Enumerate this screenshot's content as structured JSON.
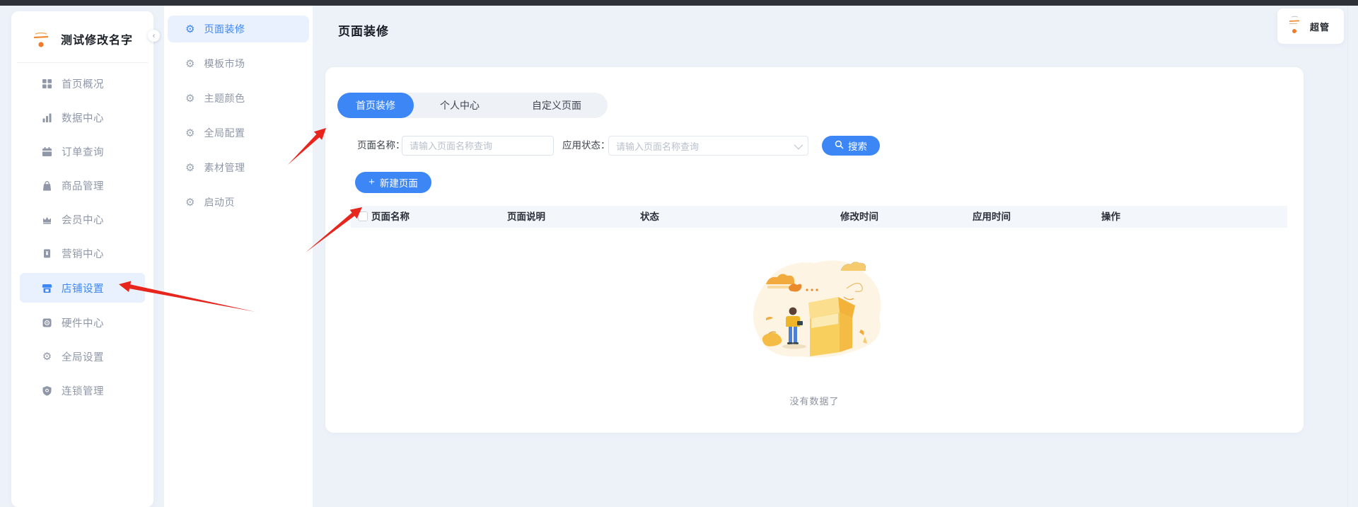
{
  "glyphs": {
    "gear": "⚙",
    "collapse": "‹",
    "plus": "+"
  },
  "colors": {
    "accent": "#3d86f6",
    "active_bg": "#e8f1fd",
    "arrow_red": "#e8251d",
    "topbar": "#2e3138",
    "page_bg": "#edf2f9"
  },
  "sidebar": {
    "logo_title": "测试修改名字",
    "items": [
      {
        "label": "首页概况",
        "icon": "dashboard-grid-icon",
        "active": false
      },
      {
        "label": "数据中心",
        "icon": "bar-chart-icon",
        "active": false
      },
      {
        "label": "订单查询",
        "icon": "calendar-icon",
        "active": false
      },
      {
        "label": "商品管理",
        "icon": "shopping-bag-icon",
        "active": false
      },
      {
        "label": "会员中心",
        "icon": "crown-icon",
        "active": false
      },
      {
        "label": "营销中心",
        "icon": "coupon-icon",
        "active": false
      },
      {
        "label": "店铺设置",
        "icon": "storefront-icon",
        "active": true
      },
      {
        "label": "硬件中心",
        "icon": "hardware-chip-icon",
        "active": false
      },
      {
        "label": "全局设置",
        "icon": "gear-icon",
        "active": false
      },
      {
        "label": "连锁管理",
        "icon": "shield-icon",
        "active": false
      }
    ]
  },
  "submenu": {
    "items": [
      {
        "label": "页面装修",
        "active": true
      },
      {
        "label": "模板市场",
        "active": false
      },
      {
        "label": "主题颜色",
        "active": false
      },
      {
        "label": "全局配置",
        "active": false
      },
      {
        "label": "素材管理",
        "active": false
      },
      {
        "label": "启动页",
        "active": false
      }
    ]
  },
  "header": {
    "title": "页面装修",
    "user_badge": "超管"
  },
  "content": {
    "tabs": [
      {
        "label": "首页装修",
        "active": true
      },
      {
        "label": "个人中心",
        "active": false
      },
      {
        "label": "自定义页面",
        "active": false
      }
    ],
    "filters": {
      "name_label": "页面名称：",
      "name_placeholder": "请输入页面名称查询",
      "status_label": "应用状态：",
      "status_placeholder": "请输入页面名称查询",
      "search_label": "搜索"
    },
    "new_page_label": "新建页面",
    "table_headers": [
      "页面名称",
      "页面说明",
      "状态",
      "修改时间",
      "应用时间",
      "操作"
    ],
    "empty_text": "没有数据了"
  }
}
